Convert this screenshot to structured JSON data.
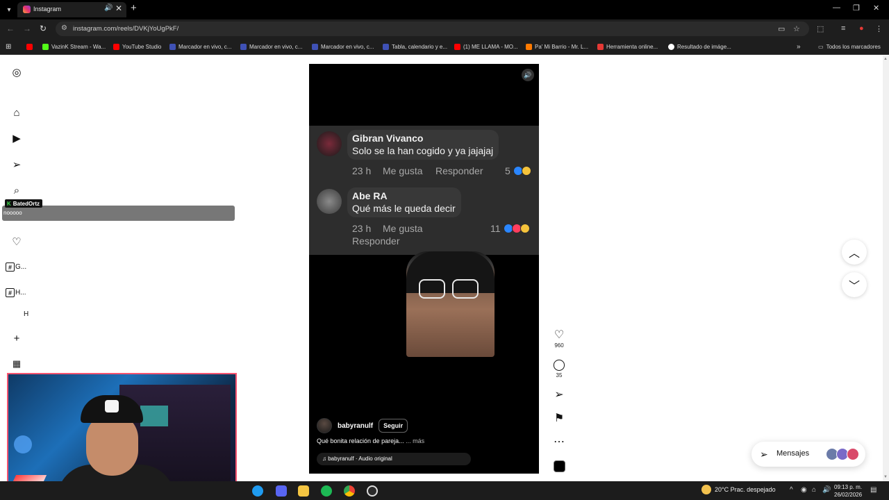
{
  "browser": {
    "tab_title": "Instagram",
    "url": "instagram.com/reels/DVKjYoUgPkF/",
    "bookmarks": [
      {
        "label": "",
        "color": "#ff0000"
      },
      {
        "label": "VazinK Stream - Wa...",
        "color": "#53fc18"
      },
      {
        "label": "YouTube Studio",
        "color": "#ff0000"
      },
      {
        "label": "Marcador en vivo, c...",
        "color": "#3f51b5"
      },
      {
        "label": "Marcador en vivo, c...",
        "color": "#3f51b5"
      },
      {
        "label": "Marcador en vivo, c...",
        "color": "#3f51b5"
      },
      {
        "label": "Tabla, calendario y e...",
        "color": "#3f51b5"
      },
      {
        "label": "(1) ME LLAMA - MO...",
        "color": "#ff0000"
      },
      {
        "label": "Pa' Mi Barrio - Mr. L...",
        "color": "#ff7a00"
      },
      {
        "label": "Herramienta online...",
        "color": "#e53935"
      },
      {
        "label": "Resultado de imáge...",
        "color": "#ffffff"
      }
    ],
    "all_bookmarks": "Todos los marcadores"
  },
  "sidebar": {
    "tags": [
      "G...",
      "H..."
    ],
    "sub_letter": "H"
  },
  "chat_overlay": {
    "username": "BatedOrtz",
    "message": "nooooo"
  },
  "reel": {
    "comments": [
      {
        "user": "Gibran Vivanco",
        "text": "Solo se la han cogido y ya jajajaj",
        "time": "23 h",
        "like": "Me gusta",
        "reply": "Responder",
        "count": "5"
      },
      {
        "user": "Abe RA",
        "text": "Qué más le queda decir",
        "time": "23 h",
        "like": "Me gusta",
        "reply": "Responder",
        "count": "11"
      }
    ],
    "username": "babyranulf",
    "follow": "Seguir",
    "caption": "Qué bonita relación de pareja...",
    "caption_more": "... más",
    "audio": "babyranulf · Audio original",
    "likes": "960",
    "comments_count": "35"
  },
  "messages": {
    "label": "Mensajes"
  },
  "taskbar": {
    "weather": "20°C  Prac. despejado",
    "time": "09:13 p. m.",
    "date": "26/02/2026"
  }
}
